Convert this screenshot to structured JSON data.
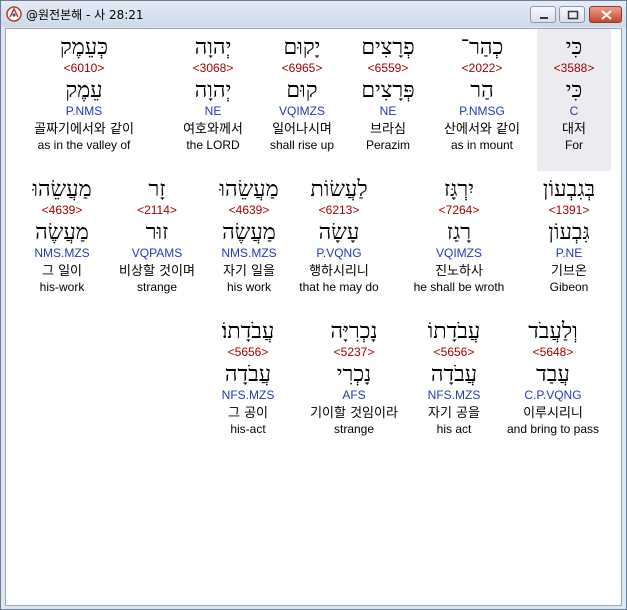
{
  "window": {
    "title": "@원전본해 - 사 28:21"
  },
  "rows": [
    [
      {
        "heb": "כְּעֵמֶק",
        "strong": "<6010>",
        "root": "עֵמֶק",
        "morph": "P.NMS",
        "ko": "골짜기에서와 같이",
        "en": "as in the valley of"
      },
      {
        "heb": "יְהוָה",
        "strong": "<3068>",
        "root": "יְהוָה",
        "morph": "NE",
        "ko": "여호와께서",
        "en": "the LORD"
      },
      {
        "heb": "יָקוּם",
        "strong": "<6965>",
        "root": "קוּם",
        "morph": "VQIMZS",
        "ko": "일어나시며",
        "en": "shall rise up"
      },
      {
        "heb": "פְרָצִים",
        "strong": "<6559>",
        "root": "פְּרָצִים",
        "morph": "NE",
        "ko": "브라심",
        "en": "Perazim"
      },
      {
        "heb": "כְהַר־",
        "strong": "<2022>",
        "root": "הַר",
        "morph": "P.NMSG",
        "ko": "산에서와 같이",
        "en": "as in mount"
      },
      {
        "heb": "כִּי",
        "strong": "<3588>",
        "root": "כִּי",
        "morph": "C",
        "ko": "대저",
        "en": "For",
        "highlight": true
      }
    ],
    [
      {
        "heb": "מַעֲשֵׂהוּ",
        "strong": "<4639>",
        "root": "מַעֲשֶׂה",
        "morph": "NMS.MZS",
        "ko": "그 일이",
        "en": "his-work"
      },
      {
        "heb": "זָר",
        "strong": "<2114>",
        "root": "זוּר",
        "morph": "VQPAMS",
        "ko": "비상할 것이며",
        "en": "strange"
      },
      {
        "heb": "מַעֲשֵׂהוּ",
        "strong": "<4639>",
        "root": "מַעֲשֶׂה",
        "morph": "NMS.MZS",
        "ko": "자기 일을",
        "en": "his work"
      },
      {
        "heb": "לַעֲשׂוֹת",
        "strong": "<6213>",
        "root": "עָשָׂה",
        "morph": "P.VQNG",
        "ko": "행하시리니",
        "en": "that he may do"
      },
      {
        "heb": "יִרְגָּז",
        "strong": "<7264>",
        "root": "רָגַז",
        "morph": "VQIMZS",
        "ko": "진노하사",
        "en": "he shall be wroth"
      },
      {
        "heb": "בְּגִבְעוֹן",
        "strong": "<1391>",
        "root": "גִּבְעוֹן",
        "morph": "P.NE",
        "ko": "기브온",
        "en": "Gibeon"
      }
    ],
    [
      {
        "heb": "עֲבֹדָתוֹ׃",
        "strong": "<5656>",
        "root": "עֲבֹדָה",
        "morph": "NFS.MZS",
        "ko": "그 공이",
        "en": "his-act"
      },
      {
        "heb": "נָכְרִיָּה",
        "strong": "<5237>",
        "root": "נָכְרִי",
        "morph": "AFS",
        "ko": "기이할 것임이라",
        "en": "strange"
      },
      {
        "heb": "עֲבֹדָתוֹ",
        "strong": "<5656>",
        "root": "עֲבֹדָה",
        "morph": "NFS.MZS",
        "ko": "자기 공을",
        "en": "his act"
      },
      {
        "heb": "וְלַעֲבֹד",
        "strong": "<5648>",
        "root": "עֲבַד",
        "morph": "C.P.VQNG",
        "ko": "이루시리니",
        "en": "and bring to pass"
      }
    ]
  ]
}
